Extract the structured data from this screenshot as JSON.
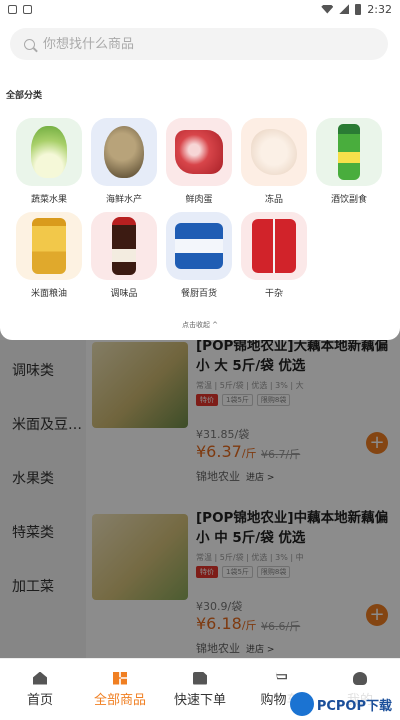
{
  "status_bar": {
    "time": "2:32"
  },
  "search": {
    "placeholder": "你想找什么商品"
  },
  "categories_title": "全部分类",
  "categories": [
    {
      "label": "蔬菜水果",
      "icon": "cabbage-icon",
      "bg": "#eaf5ea"
    },
    {
      "label": "海鲜水产",
      "icon": "fish-icon",
      "bg": "#e6ecf8"
    },
    {
      "label": "鲜肉蛋",
      "icon": "meat-icon",
      "bg": "#fbe8e8"
    },
    {
      "label": "冻品",
      "icon": "frozen-food-icon",
      "bg": "#fdeee4"
    },
    {
      "label": "酒饮副食",
      "icon": "drink-bottle-icon",
      "bg": "#eaf5ea"
    },
    {
      "label": "米面粮油",
      "icon": "oil-bottle-icon",
      "bg": "#fdf2e2"
    },
    {
      "label": "调味品",
      "icon": "soy-sauce-icon",
      "bg": "#fbe8e8"
    },
    {
      "label": "餐厨百货",
      "icon": "tissue-icon",
      "bg": "#e6ecf8"
    },
    {
      "label": "干杂",
      "icon": "sausage-icon",
      "bg": "#fbe8e8"
    }
  ],
  "collapse_text": "点击收起 ^",
  "side_categories": [
    "调味类",
    "米面及豆…",
    "水果类",
    "特菜类",
    "加工菜"
  ],
  "products": [
    {
      "title": "[POP锦地农业]大藕本地新藕偏小 大 5斤/袋 优选",
      "meta": "常温 | 5斤/袋 | 优选 | 3% | 大",
      "tags": [
        "特价",
        "1袋5斤",
        "限购8袋"
      ],
      "unit_price": "¥31.85/袋",
      "price": "¥6.37",
      "price_unit": "/斤",
      "old_price": "¥6.7/斤",
      "store": "锦地农业",
      "store_link": "进店 >"
    },
    {
      "title": "[POP锦地农业]中藕本地新藕偏小 中 5斤/袋 优选",
      "meta": "常温 | 5斤/袋 | 优选 | 3% | 中",
      "tags": [
        "特价",
        "1袋5斤",
        "限购8袋"
      ],
      "unit_price": "¥30.9/袋",
      "price": "¥6.18",
      "price_unit": "/斤",
      "old_price": "¥6.6/斤",
      "store": "锦地农业",
      "store_link": "进店 >"
    }
  ],
  "tabs": [
    {
      "label": "首页",
      "icon": "home-icon"
    },
    {
      "label": "全部商品",
      "icon": "grid-icon",
      "active": true
    },
    {
      "label": "快速下单",
      "icon": "order-icon"
    },
    {
      "label": "购物车",
      "icon": "cart-icon"
    },
    {
      "label": "我的",
      "icon": "user-icon"
    }
  ],
  "watermark": "PCPOP下载",
  "colors": {
    "accent": "#f07f22",
    "price": "#e66b1e",
    "hot_tag": "#e5352c"
  }
}
